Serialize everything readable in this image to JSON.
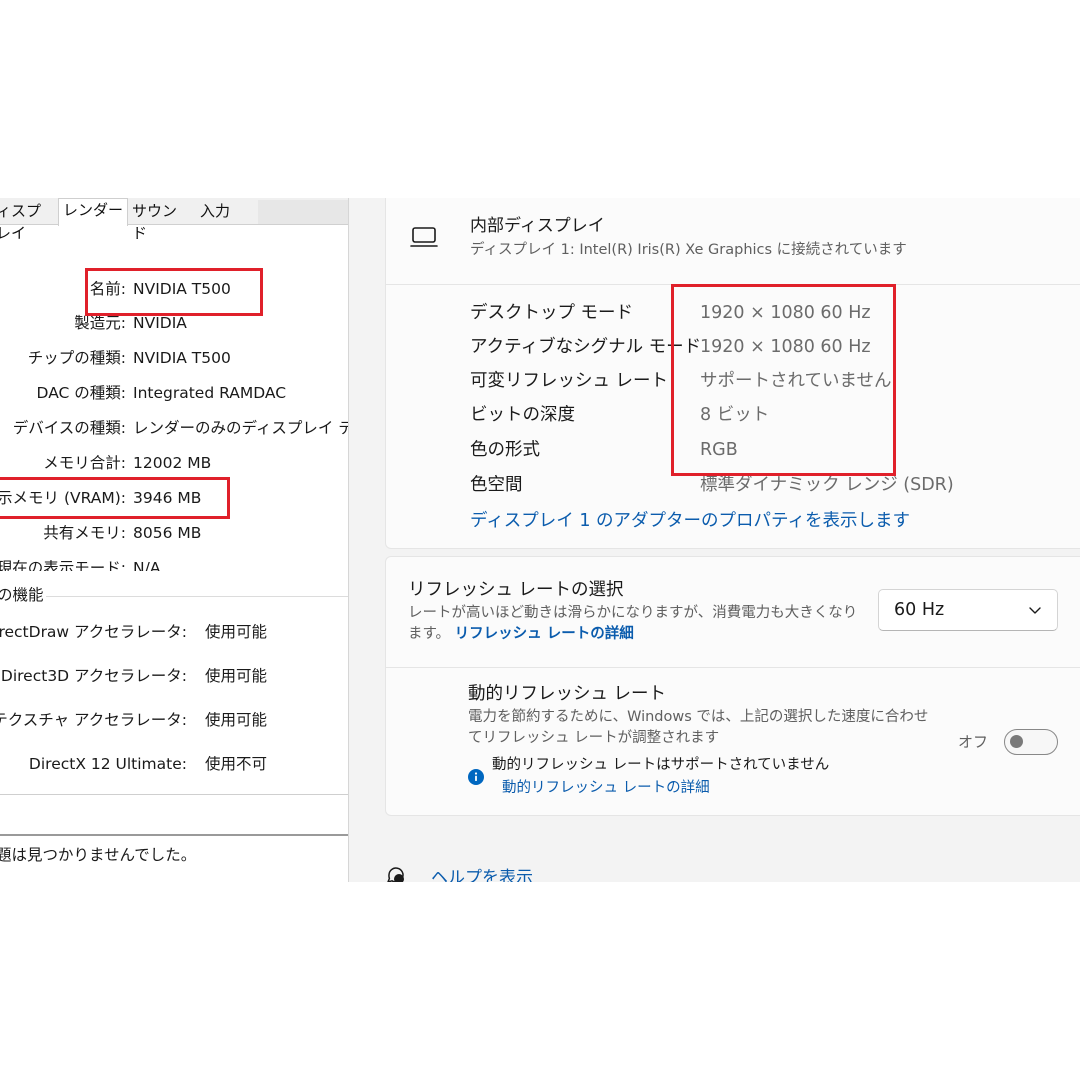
{
  "dxdiag": {
    "tabs": [
      "ィスプレイ",
      "レンダー",
      "サウンド",
      "入力"
    ],
    "active_tab": 1,
    "info_rows": [
      {
        "key": "名前:",
        "value": "NVIDIA T500"
      },
      {
        "key": "製造元:",
        "value": "NVIDIA"
      },
      {
        "key": "チップの種類:",
        "value": "NVIDIA T500"
      },
      {
        "key": "DAC の種類:",
        "value": "Integrated RAMDAC"
      },
      {
        "key": "デバイスの種類:",
        "value": "レンダーのみのディスプレイ デバイス"
      },
      {
        "key": "メモリ合計:",
        "value": "12002 MB"
      },
      {
        "key": "表示メモリ (VRAM):",
        "value": "3946 MB"
      },
      {
        "key": "共有メモリ:",
        "value": "8056 MB"
      },
      {
        "key": "現在の表示モード:",
        "value": "N/A"
      }
    ],
    "features_title": "の機能",
    "features": [
      {
        "key": "DirectDraw アクセラレータ:",
        "value": "使用可能"
      },
      {
        "key": "Direct3D アクセラレータ:",
        "value": "使用可能"
      },
      {
        "key": "AGP テクスチャ アクセラレータ:",
        "value": "使用可能"
      },
      {
        "key": "DirectX 12 Ultimate:",
        "value": "使用不可"
      }
    ],
    "notes_text": "題は見つかりませんでした。"
  },
  "settings": {
    "display": {
      "title": "内部ディスプレイ",
      "subtitle": "ディスプレイ 1: Intel(R) Iris(R) Xe Graphics に接続されています",
      "icon": "laptop-icon"
    },
    "specs": [
      {
        "key": "デスクトップ モード",
        "value": "1920 × 1080 60 Hz"
      },
      {
        "key": "アクティブなシグナル モード",
        "value": "1920 × 1080 60 Hz"
      },
      {
        "key": "可変リフレッシュ レート",
        "value": "サポートされていません"
      },
      {
        "key": "ビットの深度",
        "value": "8 ビット"
      },
      {
        "key": "色の形式",
        "value": "RGB"
      },
      {
        "key": "色空間",
        "value": "標準ダイナミック レンジ (SDR)"
      }
    ],
    "adapter_link": "ディスプレイ 1 のアダプターのプロパティを表示します",
    "refresh": {
      "title": "リフレッシュ レートの選択",
      "desc": "レートが高いほど動きは滑らかになりますが、消費電力も大きくなります。",
      "desc_link": "リフレッシュ レートの詳細",
      "selected": "60 Hz"
    },
    "dynamic": {
      "title": "動的リフレッシュ レート",
      "desc": "電力を節約するために、Windows では、上記の選択した速度に合わせてリフレッシュ レートが調整されます",
      "toggle_label": "オフ",
      "toggle_on": false,
      "note": "動的リフレッシュ レートはサポートされていません",
      "note_link": "動的リフレッシュ レートの詳細"
    },
    "help": "ヘルプを表示"
  },
  "colors": {
    "highlight": "#e0202a",
    "link": "#0b5cad",
    "settings_bg": "#f3f3f3",
    "info_blue": "#0067c0"
  }
}
